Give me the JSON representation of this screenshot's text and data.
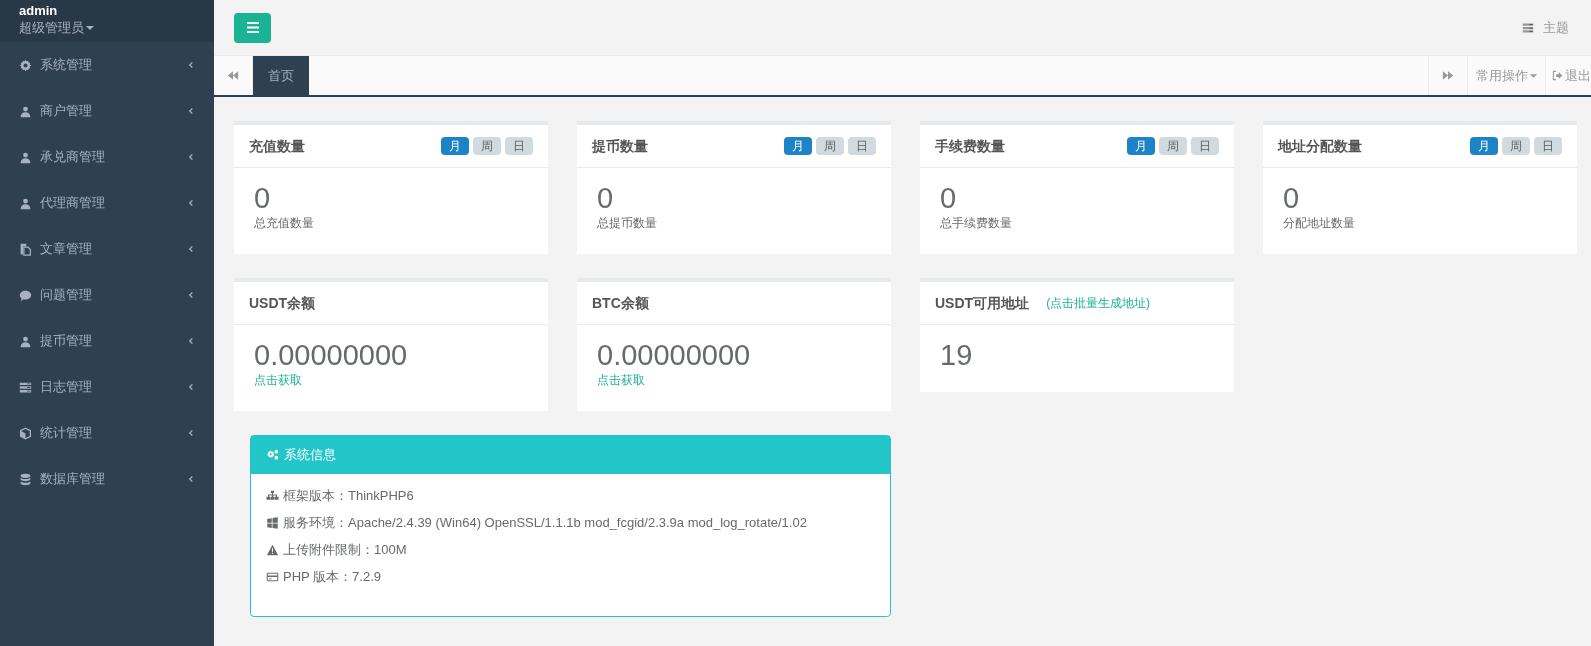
{
  "user": {
    "name": "admin",
    "role": "超级管理员"
  },
  "sidebar": {
    "items": [
      {
        "label": "系统管理",
        "kind": "gear",
        "expanded": false
      },
      {
        "label": "商户管理",
        "kind": "user",
        "expanded": false
      },
      {
        "label": "承兑商管理",
        "kind": "user",
        "expanded": false
      },
      {
        "label": "代理商管理",
        "kind": "user",
        "expanded": false
      },
      {
        "label": "文章管理",
        "kind": "copy",
        "expanded": false
      },
      {
        "label": "问题管理",
        "kind": "comment",
        "expanded": false
      },
      {
        "label": "提币管理",
        "kind": "user",
        "expanded": false
      },
      {
        "label": "日志管理",
        "kind": "tasks",
        "expanded": false
      },
      {
        "label": "统计管理",
        "kind": "cube",
        "expanded": false
      },
      {
        "label": "数据库管理",
        "kind": "database",
        "expanded": false
      }
    ]
  },
  "topbar": {
    "theme": "主题"
  },
  "tabbar": {
    "tabs": [
      {
        "label": "首页",
        "selected": true
      }
    ],
    "operations": "常用操作",
    "logout": "退出"
  },
  "stat_cards": [
    {
      "title": "充值数量",
      "periods": [
        {
          "label": "月",
          "selected": true
        },
        {
          "label": "周",
          "selected": false
        },
        {
          "label": "日",
          "selected": false
        }
      ],
      "value": "0",
      "caption": "总充值数量"
    },
    {
      "title": "提币数量",
      "periods": [
        {
          "label": "月",
          "selected": true
        },
        {
          "label": "周",
          "selected": false
        },
        {
          "label": "日",
          "selected": false
        }
      ],
      "value": "0",
      "caption": "总提币数量"
    },
    {
      "title": "手续费数量",
      "periods": [
        {
          "label": "月",
          "selected": true
        },
        {
          "label": "周",
          "selected": false
        },
        {
          "label": "日",
          "selected": false
        }
      ],
      "value": "0",
      "caption": "总手续费数量"
    },
    {
      "title": "地址分配数量",
      "periods": [
        {
          "label": "月",
          "selected": true
        },
        {
          "label": "周",
          "selected": false
        },
        {
          "label": "日",
          "selected": false
        }
      ],
      "value": "0",
      "caption": "分配地址数量"
    }
  ],
  "balance_cards": [
    {
      "title": "USDT余额",
      "value": "0.00000000",
      "link": "点击获取"
    },
    {
      "title": "BTC余额",
      "value": "0.00000000",
      "link": "点击获取"
    },
    {
      "title": "USDT可用地址",
      "header_link": "(点击批量生成地址)",
      "value": "19"
    }
  ],
  "system_info": {
    "title": "系统信息",
    "items": [
      {
        "kind": "sitemap",
        "text": "框架版本：ThinkPHP6"
      },
      {
        "kind": "windows",
        "text": "服务环境：Apache/2.4.39 (Win64) OpenSSL/1.1.1b mod_fcgid/2.3.9a mod_log_rotate/1.02"
      },
      {
        "kind": "warning",
        "text": "上传附件限制：100M"
      },
      {
        "kind": "card",
        "text": "PHP 版本：7.2.9"
      }
    ]
  }
}
